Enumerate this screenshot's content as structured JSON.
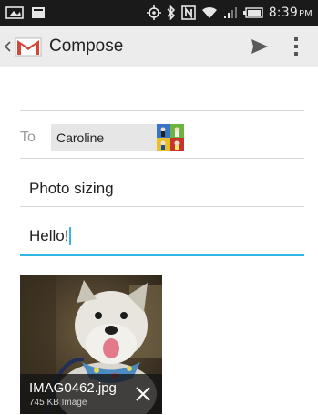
{
  "status_bar": {
    "time": "8:39",
    "time_suffix": "PM",
    "icons": [
      "image-icon",
      "notification-icon",
      "gps-icon",
      "bluetooth-icon",
      "nfc-icon",
      "wifi-icon",
      "signal-icon",
      "battery-icon"
    ],
    "background": "#1a1a1a"
  },
  "action_bar": {
    "title": "Compose",
    "icons": [
      "up-caret-icon",
      "gmail-logo-icon",
      "send-icon",
      "overflow-menu-icon"
    ],
    "background": "#ececec",
    "brand_color": "#d14836"
  },
  "compose": {
    "to_label": "To",
    "recipient": "Caroline",
    "subject": "Photo sizing",
    "body": "Hello!",
    "focus_color": "#33b5e5"
  },
  "attachment": {
    "file_name": "IMAG0462.jpg",
    "meta": "745 KB Image",
    "remove_icon": "close-icon"
  }
}
